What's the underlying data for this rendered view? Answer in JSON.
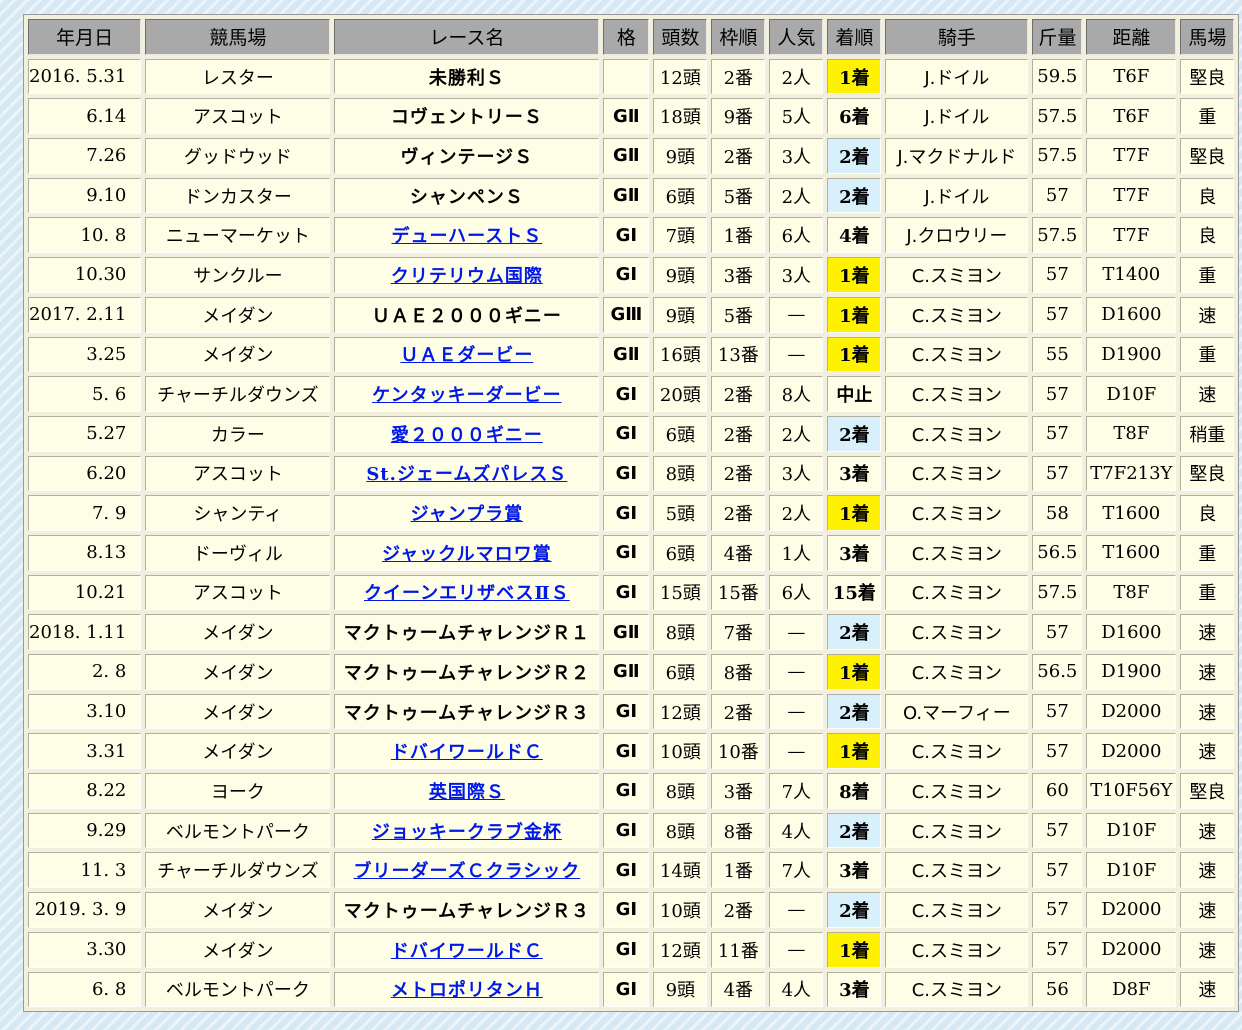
{
  "headers": [
    "年月日",
    "競馬場",
    "レース名",
    "格",
    "頭数",
    "枠順",
    "人気",
    "着順",
    "騎手",
    "斤量",
    "距離",
    "馬場"
  ],
  "rows": [
    {
      "date": "2016. 5.31",
      "course": "レスター",
      "race": "未勝利Ｓ",
      "link": false,
      "grade": "",
      "gc": "",
      "runners": "12頭",
      "gate": "2番",
      "pop": "2人",
      "finish": "1着",
      "fc": "win",
      "jockey": "J.ドイル",
      "weight": "59.5",
      "dist": "T6F",
      "going": "堅良"
    },
    {
      "date": "6.14",
      "course": "アスコット",
      "race": "コヴェントリーＳ",
      "link": false,
      "grade": "GⅡ",
      "gc": "g2",
      "runners": "18頭",
      "gate": "9番",
      "pop": "5人",
      "finish": "6着",
      "fc": "",
      "jockey": "J.ドイル",
      "weight": "57.5",
      "dist": "T6F",
      "going": "重"
    },
    {
      "date": "7.26",
      "course": "グッドウッド",
      "race": "ヴィンテージＳ",
      "link": false,
      "grade": "GⅡ",
      "gc": "g2",
      "runners": "9頭",
      "gate": "2番",
      "pop": "3人",
      "finish": "2着",
      "fc": "place",
      "jockey": "J.マクドナルド",
      "weight": "57.5",
      "dist": "T7F",
      "going": "堅良"
    },
    {
      "date": "9.10",
      "course": "ドンカスター",
      "race": "シャンペンＳ",
      "link": false,
      "grade": "GⅡ",
      "gc": "g2",
      "runners": "6頭",
      "gate": "5番",
      "pop": "2人",
      "finish": "2着",
      "fc": "place",
      "jockey": "J.ドイル",
      "weight": "57",
      "dist": "T7F",
      "going": "良"
    },
    {
      "date": "10. 8",
      "course": "ニューマーケット",
      "race": "デューハーストＳ",
      "link": true,
      "grade": "GⅠ",
      "gc": "g1",
      "runners": "7頭",
      "gate": "1番",
      "pop": "6人",
      "finish": "4着",
      "fc": "",
      "jockey": "J.クロウリー",
      "weight": "57.5",
      "dist": "T7F",
      "going": "良"
    },
    {
      "date": "10.30",
      "course": "サンクルー",
      "race": "クリテリウム国際",
      "link": true,
      "grade": "GⅠ",
      "gc": "g1",
      "runners": "9頭",
      "gate": "3番",
      "pop": "3人",
      "finish": "1着",
      "fc": "win",
      "jockey": "C.スミヨン",
      "weight": "57",
      "dist": "T1400",
      "going": "重"
    },
    {
      "date": "2017. 2.11",
      "course": "メイダン",
      "race": "ＵＡＥ２０００ギニー",
      "link": false,
      "grade": "GⅢ",
      "gc": "g3",
      "runners": "9頭",
      "gate": "5番",
      "pop": "—",
      "finish": "1着",
      "fc": "win",
      "jockey": "C.スミヨン",
      "weight": "57",
      "dist": "D1600",
      "going": "速"
    },
    {
      "date": "3.25",
      "course": "メイダン",
      "race": "ＵＡＥダービー",
      "link": true,
      "grade": "GⅡ",
      "gc": "g2",
      "runners": "16頭",
      "gate": "13番",
      "pop": "—",
      "finish": "1着",
      "fc": "win",
      "jockey": "C.スミヨン",
      "weight": "55",
      "dist": "D1900",
      "going": "重"
    },
    {
      "date": "5. 6",
      "course": "チャーチルダウンズ",
      "race": "ケンタッキーダービー",
      "link": true,
      "grade": "GⅠ",
      "gc": "g1",
      "runners": "20頭",
      "gate": "2番",
      "pop": "8人",
      "finish": "中止",
      "fc": "",
      "jockey": "C.スミヨン",
      "weight": "57",
      "dist": "D10F",
      "going": "速"
    },
    {
      "date": "5.27",
      "course": "カラー",
      "race": "愛２０００ギニー",
      "link": true,
      "grade": "GⅠ",
      "gc": "g1",
      "runners": "6頭",
      "gate": "2番",
      "pop": "2人",
      "finish": "2着",
      "fc": "place",
      "jockey": "C.スミヨン",
      "weight": "57",
      "dist": "T8F",
      "going": "稍重"
    },
    {
      "date": "6.20",
      "course": "アスコット",
      "race": "St.ジェームズパレスＳ",
      "link": true,
      "grade": "GⅠ",
      "gc": "g1",
      "runners": "8頭",
      "gate": "2番",
      "pop": "3人",
      "finish": "3着",
      "fc": "",
      "jockey": "C.スミヨン",
      "weight": "57",
      "dist": "T7F213Y",
      "going": "堅良"
    },
    {
      "date": "7. 9",
      "course": "シャンティ",
      "race": "ジャンプラ賞",
      "link": true,
      "grade": "GⅠ",
      "gc": "g1",
      "runners": "5頭",
      "gate": "2番",
      "pop": "2人",
      "finish": "1着",
      "fc": "win",
      "jockey": "C.スミヨン",
      "weight": "58",
      "dist": "T1600",
      "going": "良"
    },
    {
      "date": "8.13",
      "course": "ドーヴィル",
      "race": "ジャックルマロワ賞",
      "link": true,
      "grade": "GⅠ",
      "gc": "g1",
      "runners": "6頭",
      "gate": "4番",
      "pop": "1人",
      "finish": "3着",
      "fc": "",
      "jockey": "C.スミヨン",
      "weight": "56.5",
      "dist": "T1600",
      "going": "重"
    },
    {
      "date": "10.21",
      "course": "アスコット",
      "race": "クイーンエリザベスⅡＳ",
      "link": true,
      "grade": "GⅠ",
      "gc": "g1",
      "runners": "15頭",
      "gate": "15番",
      "pop": "6人",
      "finish": "15着",
      "fc": "",
      "jockey": "C.スミヨン",
      "weight": "57.5",
      "dist": "T8F",
      "going": "重"
    },
    {
      "date": "2018. 1.11",
      "course": "メイダン",
      "race": "マクトゥームチャレンジＲ１",
      "link": false,
      "grade": "GⅡ",
      "gc": "g2",
      "runners": "8頭",
      "gate": "7番",
      "pop": "—",
      "finish": "2着",
      "fc": "place",
      "jockey": "C.スミヨン",
      "weight": "57",
      "dist": "D1600",
      "going": "速"
    },
    {
      "date": "2. 8",
      "course": "メイダン",
      "race": "マクトゥームチャレンジＲ２",
      "link": false,
      "grade": "GⅡ",
      "gc": "g2",
      "runners": "6頭",
      "gate": "8番",
      "pop": "—",
      "finish": "1着",
      "fc": "win",
      "jockey": "C.スミヨン",
      "weight": "56.5",
      "dist": "D1900",
      "going": "速"
    },
    {
      "date": "3.10",
      "course": "メイダン",
      "race": "マクトゥームチャレンジＲ３",
      "link": false,
      "grade": "GⅠ",
      "gc": "g1",
      "runners": "12頭",
      "gate": "2番",
      "pop": "—",
      "finish": "2着",
      "fc": "place",
      "jockey": "O.マーフィー",
      "weight": "57",
      "dist": "D2000",
      "going": "速"
    },
    {
      "date": "3.31",
      "course": "メイダン",
      "race": "ドバイワールドＣ",
      "link": true,
      "grade": "GⅠ",
      "gc": "g1",
      "runners": "10頭",
      "gate": "10番",
      "pop": "—",
      "finish": "1着",
      "fc": "win",
      "jockey": "C.スミヨン",
      "weight": "57",
      "dist": "D2000",
      "going": "速"
    },
    {
      "date": "8.22",
      "course": "ヨーク",
      "race": "英国際Ｓ",
      "link": true,
      "grade": "GⅠ",
      "gc": "g1",
      "runners": "8頭",
      "gate": "3番",
      "pop": "7人",
      "finish": "8着",
      "fc": "",
      "jockey": "C.スミヨン",
      "weight": "60",
      "dist": "T10F56Y",
      "going": "堅良"
    },
    {
      "date": "9.29",
      "course": "ベルモントパーク",
      "race": "ジョッキークラブ金杯",
      "link": true,
      "grade": "GⅠ",
      "gc": "g1",
      "runners": "8頭",
      "gate": "8番",
      "pop": "4人",
      "finish": "2着",
      "fc": "place",
      "jockey": "C.スミヨン",
      "weight": "57",
      "dist": "D10F",
      "going": "速"
    },
    {
      "date": "11. 3",
      "course": "チャーチルダウンズ",
      "race": "ブリーダーズＣクラシック",
      "link": true,
      "grade": "GⅠ",
      "gc": "g1",
      "runners": "14頭",
      "gate": "1番",
      "pop": "7人",
      "finish": "3着",
      "fc": "",
      "jockey": "C.スミヨン",
      "weight": "57",
      "dist": "D10F",
      "going": "速"
    },
    {
      "date": "2019. 3. 9",
      "course": "メイダン",
      "race": "マクトゥームチャレンジＲ３",
      "link": false,
      "grade": "GⅠ",
      "gc": "g1",
      "runners": "10頭",
      "gate": "2番",
      "pop": "—",
      "finish": "2着",
      "fc": "place",
      "jockey": "C.スミヨン",
      "weight": "57",
      "dist": "D2000",
      "going": "速"
    },
    {
      "date": "3.30",
      "course": "メイダン",
      "race": "ドバイワールドＣ",
      "link": true,
      "grade": "GⅠ",
      "gc": "g1",
      "runners": "12頭",
      "gate": "11番",
      "pop": "—",
      "finish": "1着",
      "fc": "win",
      "jockey": "C.スミヨン",
      "weight": "57",
      "dist": "D2000",
      "going": "速"
    },
    {
      "date": "6. 8",
      "course": "ベルモントパーク",
      "race": "メトロポリタンＨ",
      "link": true,
      "grade": "GⅠ",
      "gc": "g1",
      "runners": "9頭",
      "gate": "4番",
      "pop": "4人",
      "finish": "3着",
      "fc": "",
      "jockey": "C.スミヨン",
      "weight": "56",
      "dist": "D8F",
      "going": "速"
    }
  ]
}
